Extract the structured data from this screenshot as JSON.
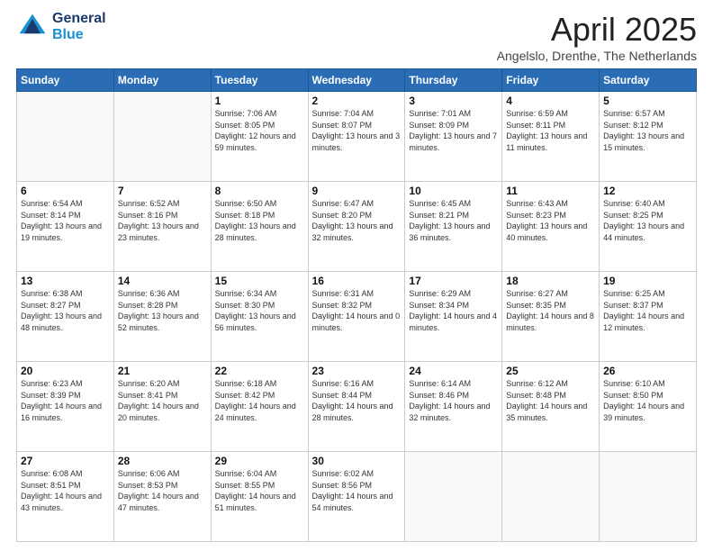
{
  "logo": {
    "line1": "General",
    "line2": "Blue"
  },
  "header": {
    "month": "April 2025",
    "location": "Angelslo, Drenthe, The Netherlands"
  },
  "weekdays": [
    "Sunday",
    "Monday",
    "Tuesday",
    "Wednesday",
    "Thursday",
    "Friday",
    "Saturday"
  ],
  "weeks": [
    [
      {
        "day": "",
        "sunrise": "",
        "sunset": "",
        "daylight": ""
      },
      {
        "day": "",
        "sunrise": "",
        "sunset": "",
        "daylight": ""
      },
      {
        "day": "1",
        "sunrise": "Sunrise: 7:06 AM",
        "sunset": "Sunset: 8:05 PM",
        "daylight": "Daylight: 12 hours and 59 minutes."
      },
      {
        "day": "2",
        "sunrise": "Sunrise: 7:04 AM",
        "sunset": "Sunset: 8:07 PM",
        "daylight": "Daylight: 13 hours and 3 minutes."
      },
      {
        "day": "3",
        "sunrise": "Sunrise: 7:01 AM",
        "sunset": "Sunset: 8:09 PM",
        "daylight": "Daylight: 13 hours and 7 minutes."
      },
      {
        "day": "4",
        "sunrise": "Sunrise: 6:59 AM",
        "sunset": "Sunset: 8:11 PM",
        "daylight": "Daylight: 13 hours and 11 minutes."
      },
      {
        "day": "5",
        "sunrise": "Sunrise: 6:57 AM",
        "sunset": "Sunset: 8:12 PM",
        "daylight": "Daylight: 13 hours and 15 minutes."
      }
    ],
    [
      {
        "day": "6",
        "sunrise": "Sunrise: 6:54 AM",
        "sunset": "Sunset: 8:14 PM",
        "daylight": "Daylight: 13 hours and 19 minutes."
      },
      {
        "day": "7",
        "sunrise": "Sunrise: 6:52 AM",
        "sunset": "Sunset: 8:16 PM",
        "daylight": "Daylight: 13 hours and 23 minutes."
      },
      {
        "day": "8",
        "sunrise": "Sunrise: 6:50 AM",
        "sunset": "Sunset: 8:18 PM",
        "daylight": "Daylight: 13 hours and 28 minutes."
      },
      {
        "day": "9",
        "sunrise": "Sunrise: 6:47 AM",
        "sunset": "Sunset: 8:20 PM",
        "daylight": "Daylight: 13 hours and 32 minutes."
      },
      {
        "day": "10",
        "sunrise": "Sunrise: 6:45 AM",
        "sunset": "Sunset: 8:21 PM",
        "daylight": "Daylight: 13 hours and 36 minutes."
      },
      {
        "day": "11",
        "sunrise": "Sunrise: 6:43 AM",
        "sunset": "Sunset: 8:23 PM",
        "daylight": "Daylight: 13 hours and 40 minutes."
      },
      {
        "day": "12",
        "sunrise": "Sunrise: 6:40 AM",
        "sunset": "Sunset: 8:25 PM",
        "daylight": "Daylight: 13 hours and 44 minutes."
      }
    ],
    [
      {
        "day": "13",
        "sunrise": "Sunrise: 6:38 AM",
        "sunset": "Sunset: 8:27 PM",
        "daylight": "Daylight: 13 hours and 48 minutes."
      },
      {
        "day": "14",
        "sunrise": "Sunrise: 6:36 AM",
        "sunset": "Sunset: 8:28 PM",
        "daylight": "Daylight: 13 hours and 52 minutes."
      },
      {
        "day": "15",
        "sunrise": "Sunrise: 6:34 AM",
        "sunset": "Sunset: 8:30 PM",
        "daylight": "Daylight: 13 hours and 56 minutes."
      },
      {
        "day": "16",
        "sunrise": "Sunrise: 6:31 AM",
        "sunset": "Sunset: 8:32 PM",
        "daylight": "Daylight: 14 hours and 0 minutes."
      },
      {
        "day": "17",
        "sunrise": "Sunrise: 6:29 AM",
        "sunset": "Sunset: 8:34 PM",
        "daylight": "Daylight: 14 hours and 4 minutes."
      },
      {
        "day": "18",
        "sunrise": "Sunrise: 6:27 AM",
        "sunset": "Sunset: 8:35 PM",
        "daylight": "Daylight: 14 hours and 8 minutes."
      },
      {
        "day": "19",
        "sunrise": "Sunrise: 6:25 AM",
        "sunset": "Sunset: 8:37 PM",
        "daylight": "Daylight: 14 hours and 12 minutes."
      }
    ],
    [
      {
        "day": "20",
        "sunrise": "Sunrise: 6:23 AM",
        "sunset": "Sunset: 8:39 PM",
        "daylight": "Daylight: 14 hours and 16 minutes."
      },
      {
        "day": "21",
        "sunrise": "Sunrise: 6:20 AM",
        "sunset": "Sunset: 8:41 PM",
        "daylight": "Daylight: 14 hours and 20 minutes."
      },
      {
        "day": "22",
        "sunrise": "Sunrise: 6:18 AM",
        "sunset": "Sunset: 8:42 PM",
        "daylight": "Daylight: 14 hours and 24 minutes."
      },
      {
        "day": "23",
        "sunrise": "Sunrise: 6:16 AM",
        "sunset": "Sunset: 8:44 PM",
        "daylight": "Daylight: 14 hours and 28 minutes."
      },
      {
        "day": "24",
        "sunrise": "Sunrise: 6:14 AM",
        "sunset": "Sunset: 8:46 PM",
        "daylight": "Daylight: 14 hours and 32 minutes."
      },
      {
        "day": "25",
        "sunrise": "Sunrise: 6:12 AM",
        "sunset": "Sunset: 8:48 PM",
        "daylight": "Daylight: 14 hours and 35 minutes."
      },
      {
        "day": "26",
        "sunrise": "Sunrise: 6:10 AM",
        "sunset": "Sunset: 8:50 PM",
        "daylight": "Daylight: 14 hours and 39 minutes."
      }
    ],
    [
      {
        "day": "27",
        "sunrise": "Sunrise: 6:08 AM",
        "sunset": "Sunset: 8:51 PM",
        "daylight": "Daylight: 14 hours and 43 minutes."
      },
      {
        "day": "28",
        "sunrise": "Sunrise: 6:06 AM",
        "sunset": "Sunset: 8:53 PM",
        "daylight": "Daylight: 14 hours and 47 minutes."
      },
      {
        "day": "29",
        "sunrise": "Sunrise: 6:04 AM",
        "sunset": "Sunset: 8:55 PM",
        "daylight": "Daylight: 14 hours and 51 minutes."
      },
      {
        "day": "30",
        "sunrise": "Sunrise: 6:02 AM",
        "sunset": "Sunset: 8:56 PM",
        "daylight": "Daylight: 14 hours and 54 minutes."
      },
      {
        "day": "",
        "sunrise": "",
        "sunset": "",
        "daylight": ""
      },
      {
        "day": "",
        "sunrise": "",
        "sunset": "",
        "daylight": ""
      },
      {
        "day": "",
        "sunrise": "",
        "sunset": "",
        "daylight": ""
      }
    ]
  ]
}
